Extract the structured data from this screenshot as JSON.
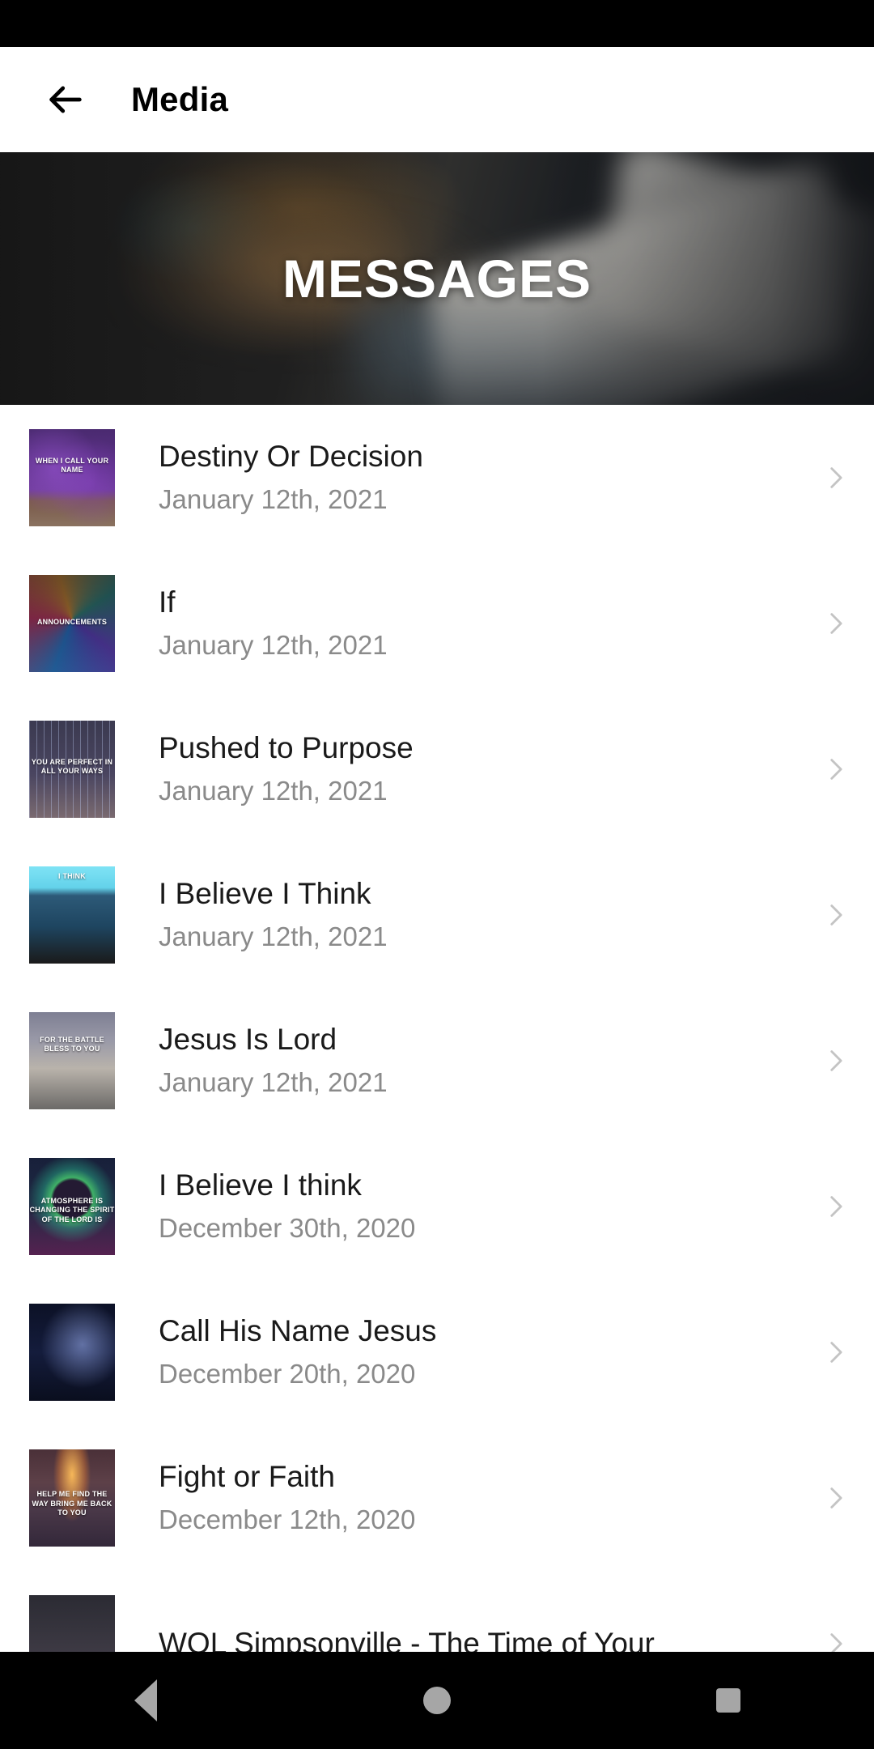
{
  "status_bar": {
    "background": "#000000"
  },
  "app_bar": {
    "back_icon": "arrow-left-icon",
    "title": "Media"
  },
  "hero": {
    "title": "MESSAGES",
    "image_description": "blurred photo of hands holding an open book",
    "background": "#262626"
  },
  "list": {
    "items": [
      {
        "title": "Destiny Or Decision",
        "date": "January 12th, 2021",
        "thumb_class": "t1",
        "thumb_text": "WHEN I CALL YOUR NAME",
        "thumb_text_top": "28%",
        "chevron": "chevron-right-icon"
      },
      {
        "title": "If",
        "date": "January 12th, 2021",
        "thumb_class": "t2",
        "thumb_text": "ANNOUNCEMENTS",
        "thumb_text_top": "44%",
        "chevron": "chevron-right-icon"
      },
      {
        "title": "Pushed to Purpose",
        "date": "January 12th, 2021",
        "thumb_class": "t3",
        "thumb_text": "YOU ARE PERFECT IN ALL YOUR WAYS",
        "thumb_text_top": "38%",
        "chevron": "chevron-right-icon"
      },
      {
        "title": "I Believe I Think",
        "date": "January 12th, 2021",
        "thumb_class": "t4",
        "thumb_text": "I THINK",
        "thumb_text_top": "6%",
        "chevron": "chevron-right-icon"
      },
      {
        "title": "Jesus Is Lord",
        "date": "January 12th, 2021",
        "thumb_class": "t5",
        "thumb_text": "FOR THE BATTLE BLESS TO YOU",
        "thumb_text_top": "24%",
        "chevron": "chevron-right-icon"
      },
      {
        "title": "I Believe I think",
        "date": "December 30th, 2020",
        "thumb_class": "t6",
        "thumb_text": "ATMOSPHERE IS CHANGING THE SPIRIT OF THE LORD IS",
        "thumb_text_top": "40%",
        "chevron": "chevron-right-icon"
      },
      {
        "title": "Call His Name Jesus",
        "date": "December 20th, 2020",
        "thumb_class": "t7",
        "thumb_text": "",
        "thumb_text_top": "40%",
        "chevron": "chevron-right-icon"
      },
      {
        "title": "Fight or Faith",
        "date": "December 12th, 2020",
        "thumb_class": "t8",
        "thumb_text": "HELP ME FIND THE WAY BRING ME BACK TO YOU",
        "thumb_text_top": "42%",
        "chevron": "chevron-right-icon"
      },
      {
        "title": "WOL Simpsonville - The Time of Your",
        "date": "",
        "thumb_class": "t9",
        "thumb_text": "",
        "thumb_text_top": "40%",
        "chevron": "chevron-right-icon"
      }
    ]
  },
  "nav_bar": {
    "back_label": "back-button",
    "home_label": "home-button",
    "recents_label": "recents-button",
    "icon_color": "#a6a6a6",
    "background": "#000000"
  }
}
